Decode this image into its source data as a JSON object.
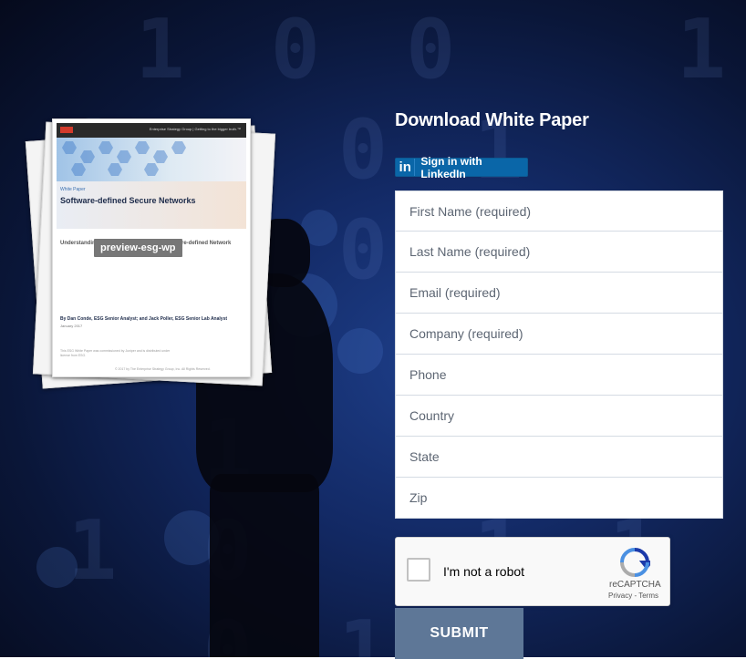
{
  "form": {
    "heading": "Download White Paper",
    "linkedin": {
      "icon_text": "in",
      "label": "Sign in with LinkedIn"
    },
    "fields": [
      {
        "name": "first-name-field",
        "placeholder": "First Name (required)"
      },
      {
        "name": "last-name-field",
        "placeholder": "Last Name (required)"
      },
      {
        "name": "email-field",
        "placeholder": "Email (required)"
      },
      {
        "name": "company-field",
        "placeholder": "Company (required)"
      },
      {
        "name": "phone-field",
        "placeholder": "Phone"
      },
      {
        "name": "country-field",
        "placeholder": "Country"
      },
      {
        "name": "state-field",
        "placeholder": "State"
      },
      {
        "name": "zip-field",
        "placeholder": "Zip"
      }
    ],
    "captcha": {
      "label": "I'm not a robot",
      "brand": "reCAPTCHA",
      "privacy": "Privacy",
      "separator": " - ",
      "terms": "Terms"
    },
    "submit_label": "SUBMIT"
  },
  "preview": {
    "tag": "preview-esg-wp",
    "doc": {
      "header_tag": "Enterprise Strategy Group | Getting to the bigger truth.™",
      "label": "White Paper",
      "title": "Software-defined Secure Networks",
      "subtitle": "Understanding the Value of the Modern Software-defined Network",
      "authors": "By Dan Conde, ESG Senior Analyst; and Jack Poller, ESG Senior Lab Analyst",
      "date": "January 2017",
      "fine_print": "This ESG White Paper was commissioned by Juniper and is distributed under license from ESG.",
      "copyright": "© 2017 by The Enterprise Strategy Group, Inc. All Rights Reserved."
    }
  },
  "colors": {
    "submit_bg": "#5e7797",
    "linkedin_blue": "#0a66a8",
    "background_navy": "#132a66"
  }
}
